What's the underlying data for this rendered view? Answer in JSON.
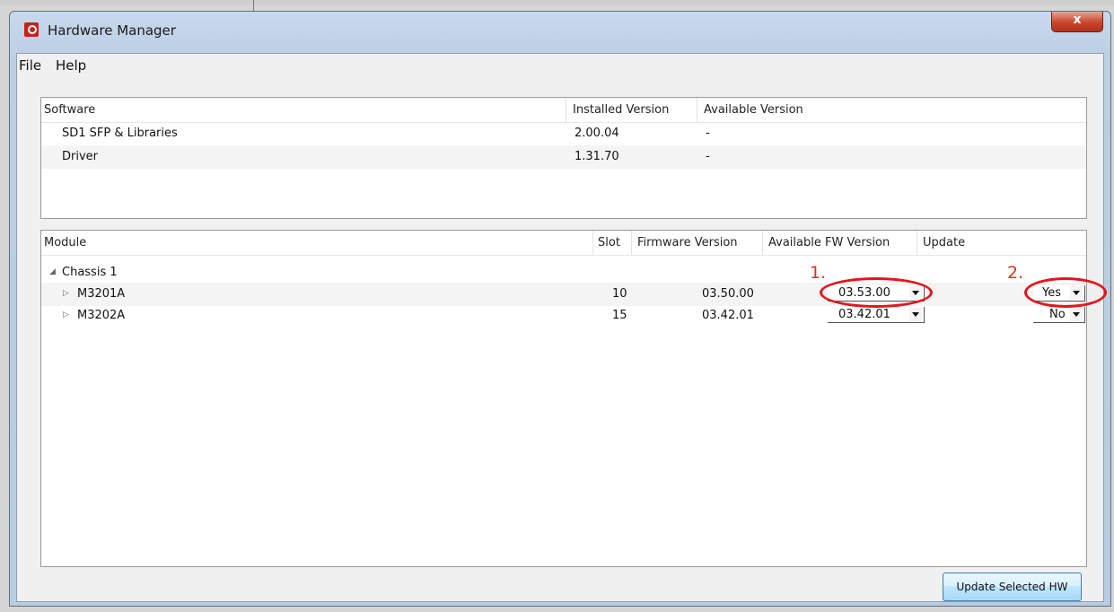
{
  "window": {
    "title": "Hardware Manager",
    "close_label": "x"
  },
  "menu": {
    "items": [
      "File",
      "Help"
    ]
  },
  "software_table": {
    "columns": [
      "Software",
      "Installed Version",
      "Available Version"
    ],
    "rows": [
      {
        "name": "SD1 SFP & Libraries",
        "installed": "2.00.04",
        "available": "-"
      },
      {
        "name": "Driver",
        "installed": "1.31.70",
        "available": "-"
      }
    ]
  },
  "module_table": {
    "columns": [
      "Module",
      "Slot",
      "Firmware Version",
      "Available FW Version",
      "Update"
    ],
    "chassis": "Chassis 1",
    "rows": [
      {
        "module": "M3201A",
        "slot": "10",
        "firmware": "03.50.00",
        "available_fw": "03.53.00",
        "update": "Yes"
      },
      {
        "module": "M3202A",
        "slot": "15",
        "firmware": "03.42.01",
        "available_fw": "03.42.01",
        "update": "No"
      }
    ]
  },
  "annotations": {
    "first": "1.",
    "second": "2.",
    "color": "#e3161b"
  },
  "buttons": {
    "update_selected": "Update Selected HW"
  }
}
